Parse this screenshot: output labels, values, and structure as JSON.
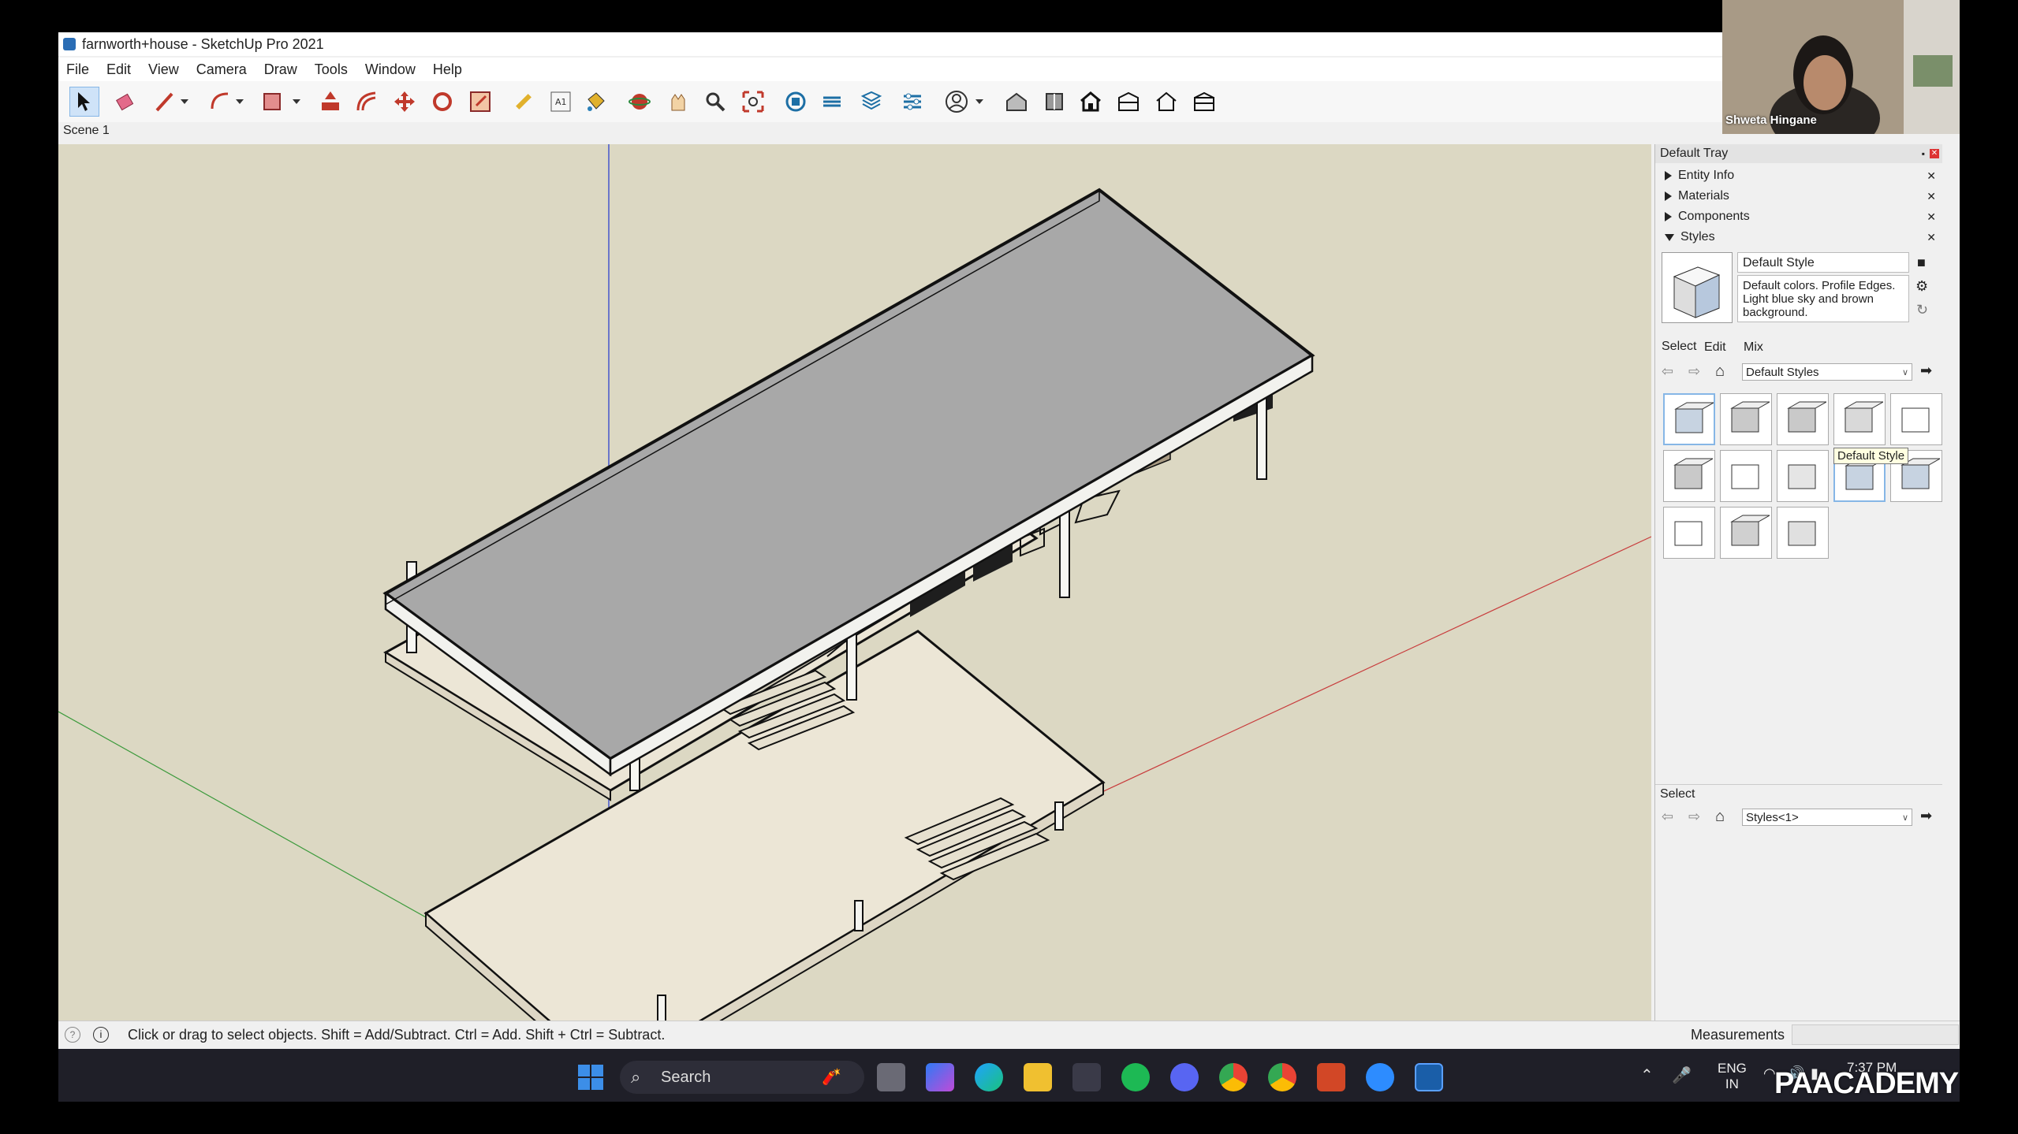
{
  "window": {
    "title": "farnworth+house - SketchUp Pro 2021",
    "menu": [
      "File",
      "Edit",
      "View",
      "Camera",
      "Draw",
      "Tools",
      "Window",
      "Help"
    ],
    "scene_tab": "Scene 1"
  },
  "toolbar": {
    "icons": [
      "select-tool-icon",
      "eraser-icon",
      "line-tool-icon",
      "dropdown-arrow-icon",
      "arc-tool-icon",
      "dropdown-arrow-icon",
      "rectangle-tool-icon",
      "dropdown-arrow-icon",
      "push-pull-icon",
      "offset-icon",
      "move-icon",
      "rotate-icon",
      "scale-icon",
      "tape-measure-icon",
      "text-tool-icon",
      "paint-bucket-icon",
      "orbit-icon",
      "pan-icon",
      "zoom-icon",
      "zoom-extents-icon",
      "warehouse-icon",
      "extension-warehouse-icon",
      "layout-icon",
      "extension-manager-icon",
      "account-icon",
      "dropdown-arrow-icon",
      "section-plane-icon",
      "section-cut-icon",
      "house-icon-1",
      "house-icon-2",
      "house-icon-3",
      "house-icon-4"
    ]
  },
  "tray": {
    "title": "Default Tray",
    "panels": [
      {
        "label": "Entity Info",
        "expanded": false
      },
      {
        "label": "Materials",
        "expanded": false
      },
      {
        "label": "Components",
        "expanded": false
      },
      {
        "label": "Styles",
        "expanded": true
      }
    ],
    "style_name": "Default Style",
    "style_description": "Default colors. Profile Edges. Light blue sky and brown background.",
    "tabs": [
      "Select",
      "Edit",
      "Mix"
    ],
    "collection_select": "Default Styles",
    "tooltip": "Default Style",
    "lower_label": "Select",
    "lower_select": "Styles<1>"
  },
  "status": {
    "hint": "Click or drag to select objects. Shift = Add/Subtract. Ctrl = Add. Shift + Ctrl = Subtract.",
    "measurements_label": "Measurements"
  },
  "taskbar": {
    "search_placeholder": "Search",
    "lang_top": "ENG",
    "lang_bottom": "IN",
    "time": "7:37 PM"
  },
  "overlay": {
    "webcam_name": "Shweta Hingane",
    "watermark": "PAACADEMY"
  },
  "colors": {
    "viewport_bg": "#dcd8c3",
    "roof": "#a8a8a8",
    "deck": "#ece6d6",
    "taskbar": "#1f1f28",
    "accent": "#2a6db5"
  }
}
